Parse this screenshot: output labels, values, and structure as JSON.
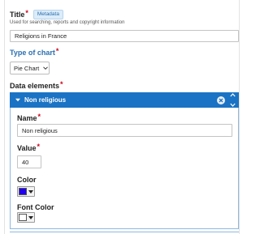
{
  "title_field": {
    "label": "Title",
    "badge": "Metadata",
    "hint": "Used for searching, reports and copyright information",
    "value": "Religions in France"
  },
  "chart_type": {
    "label": "Type of chart",
    "selected": "Pie Chart"
  },
  "data_elements": {
    "label": "Data elements",
    "item": {
      "header": "Non religious",
      "name_label": "Name",
      "name_value": "Non religious",
      "value_label": "Value",
      "value_value": "40",
      "color_label": "Color",
      "color_value": "#2200ee",
      "font_color_label": "Font Color",
      "font_color_value": "#ffffff"
    }
  },
  "required_marker": "*"
}
